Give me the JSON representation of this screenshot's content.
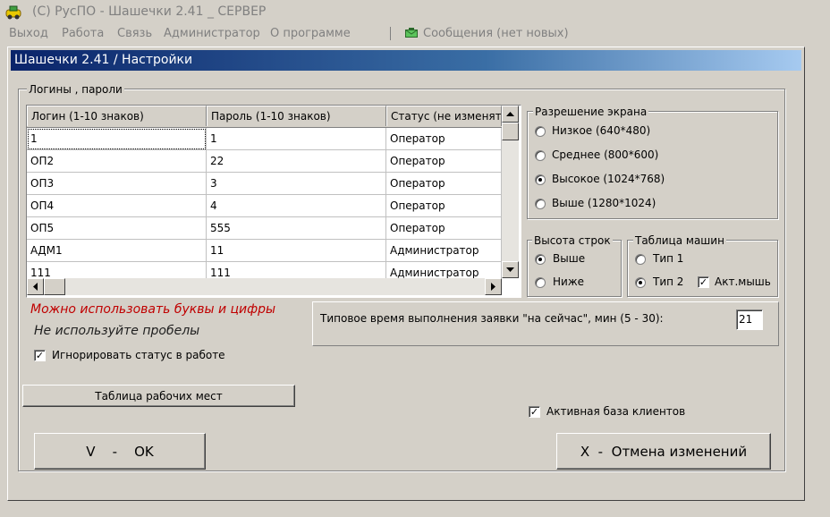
{
  "window": {
    "title": "(C) РусПО - Шашечки 2.41 _ СЕРВЕР"
  },
  "menu": {
    "items": [
      "Выход",
      "Работа",
      "Связь",
      "Администратор",
      "О программе"
    ],
    "messages": "Сообщения (нет новых)"
  },
  "dialog": {
    "title": "Шашечки 2.41 / Настройки"
  },
  "logins": {
    "group_label": "Логины , пароли",
    "columns": [
      "Логин (1-10 знаков)",
      "Пароль (1-10 знаков)",
      "Статус (не изменят"
    ],
    "rows": [
      [
        "1",
        "1",
        "Оператор"
      ],
      [
        "ОП2",
        "22",
        "Оператор"
      ],
      [
        "ОП3",
        "3",
        "Оператор"
      ],
      [
        "ОП4",
        "4",
        "Оператор"
      ],
      [
        "ОП5",
        "555",
        "Оператор"
      ],
      [
        "АДМ1",
        "11",
        "Администратор"
      ],
      [
        "111",
        "111",
        "Администратор"
      ]
    ]
  },
  "resolution": {
    "group_label": "Разрешение экрана",
    "options": [
      "Низкое (640*480)",
      "Среднее (800*600)",
      "Высокое (1024*768)",
      "Выше (1280*1024)"
    ],
    "selected": 2
  },
  "row_height": {
    "group_label": "Высота строк",
    "options": [
      "Выше",
      "Ниже"
    ],
    "selected": 0
  },
  "cars_table": {
    "group_label": "Таблица машин",
    "options": [
      "Тип 1",
      "Тип 2"
    ],
    "selected": 1,
    "mouse_label": "Акт.мышь",
    "mouse_checked": true
  },
  "hints": {
    "letters_digits": "Можно использовать буквы и цифры",
    "no_spaces": "Не используйте пробелы"
  },
  "ignore_status": {
    "label": "Игнорировать статус в работе",
    "checked": true
  },
  "workplaces_button": "Таблица рабочих мест",
  "typical_time": {
    "label": "Типовое время  выполнения  заявки  \"на сейчас\", мин (5 - 30):",
    "value": "21"
  },
  "active_clients": {
    "label": "Активная база клиентов",
    "checked": true
  },
  "ok_button": "V    -    OK",
  "cancel_button": "X  -  Отмена изменений"
}
